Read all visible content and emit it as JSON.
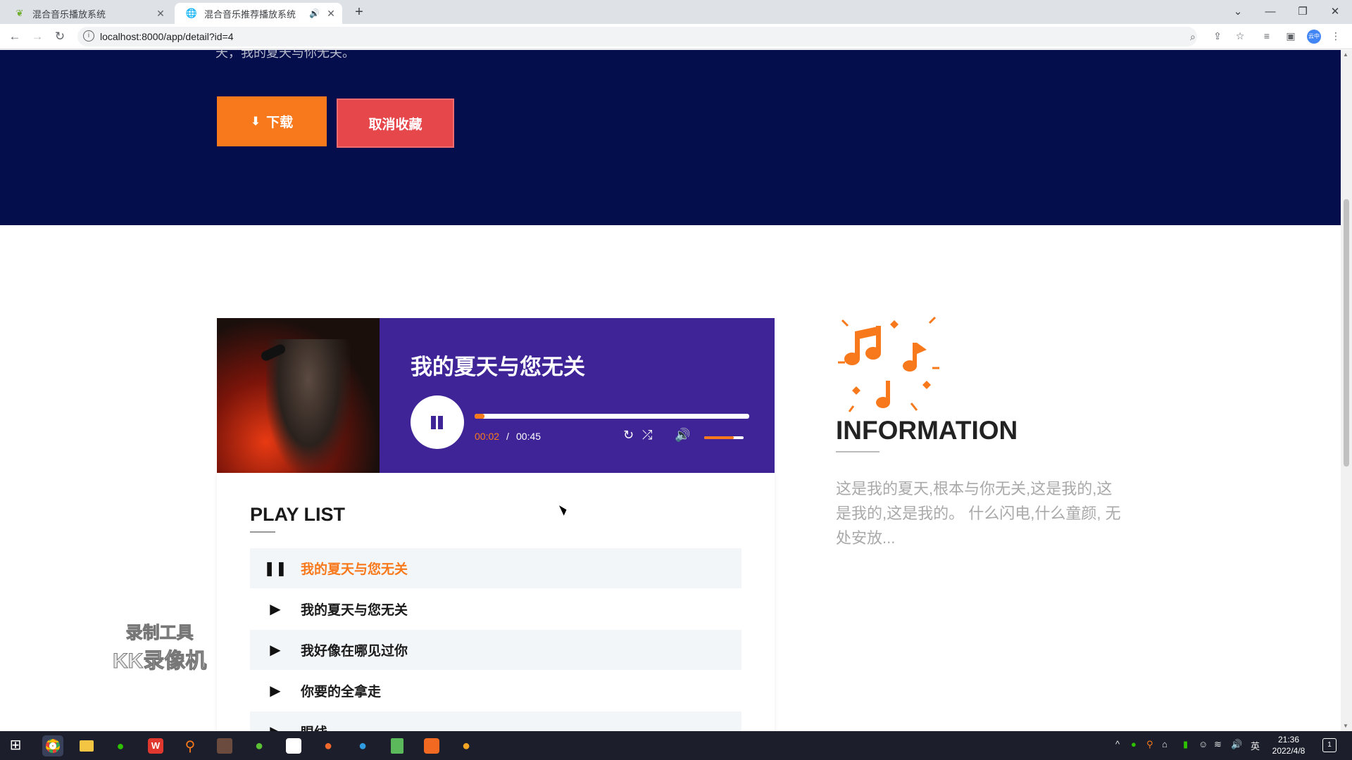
{
  "browser": {
    "tabs": [
      {
        "title": "混合音乐播放系统",
        "active": false,
        "icon": "leaf-icon"
      },
      {
        "title": "混合音乐推荐播放系统",
        "active": true,
        "icon": "globe-icon",
        "audio": true
      }
    ],
    "url": "localhost:8000/app/detail?id=4",
    "avatar_text": "云中"
  },
  "hero": {
    "cut_text": "天，我的夏天与你无关。",
    "download_label": "下载",
    "unfavorite_label": "取消收藏"
  },
  "player": {
    "title": "我的夏天与您无关",
    "current_time": "00:02",
    "separator": "/",
    "duration": "00:45",
    "progress_fraction": 0.035,
    "volume_fraction": 0.75
  },
  "playlist": {
    "heading": "PLAY LIST",
    "items": [
      {
        "name": "我的夏天与您无关",
        "playing": true
      },
      {
        "name": "我的夏天与您无关",
        "playing": false
      },
      {
        "name": "我好像在哪见过你",
        "playing": false
      },
      {
        "name": "你要的全拿走",
        "playing": false
      },
      {
        "name": "眼线",
        "playing": false
      }
    ]
  },
  "information": {
    "heading": "INFORMATION",
    "description": "这是我的夏天,根本与你无关,这是我的,这是我的,这是我的。 什么闪电,什么童颜, 无处安放..."
  },
  "watermark": {
    "line1": "录制工具",
    "line2": "KK录像机"
  },
  "taskbar": {
    "time": "21:36",
    "date": "2022/4/8",
    "ime": "英",
    "notifications": "1"
  },
  "colors": {
    "accent": "#f8791c",
    "hero_bg": "#050e4c",
    "player_bg": "#3f2497",
    "unfavorite": "#e5474b"
  }
}
